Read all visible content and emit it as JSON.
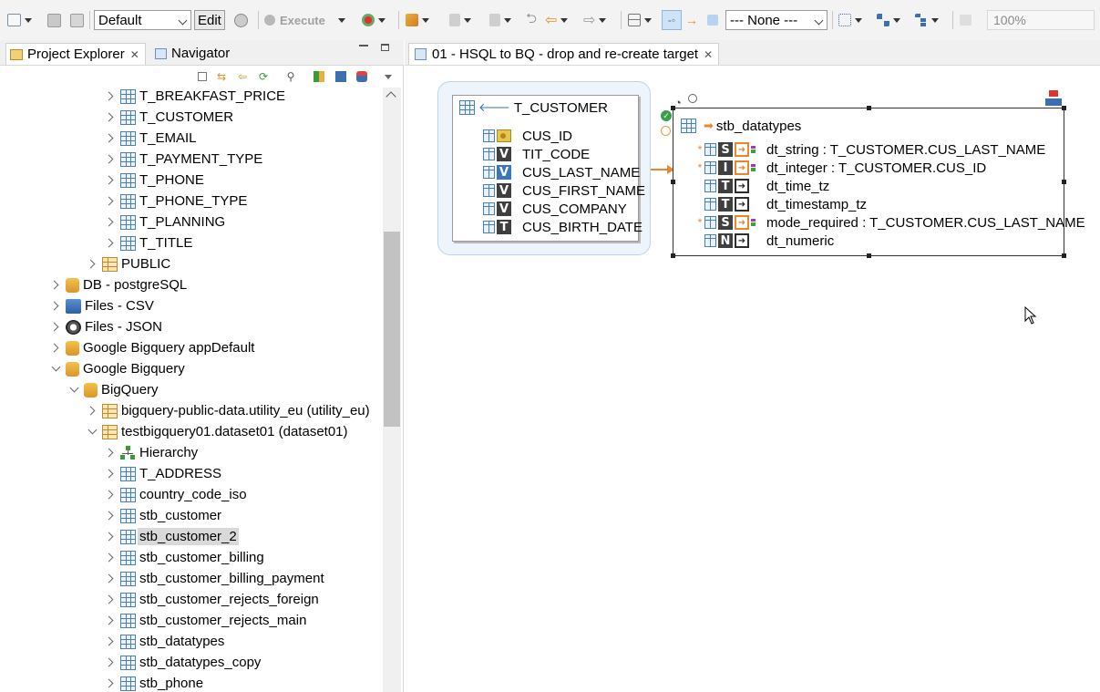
{
  "toolbar": {
    "profile_select": "Default",
    "edit_label": "Edit",
    "execute_label": "Execute",
    "none_select": "--- None ---",
    "zoom_value": "100%"
  },
  "left_panel": {
    "tabs": [
      {
        "label": "Project Explorer"
      },
      {
        "label": "Navigator"
      }
    ],
    "tree": [
      {
        "label": "T_BREAKFAST_PRICE",
        "icon": "table-icon"
      },
      {
        "label": "T_CUSTOMER",
        "icon": "table-icon"
      },
      {
        "label": "T_EMAIL",
        "icon": "table-icon"
      },
      {
        "label": "T_PAYMENT_TYPE",
        "icon": "table-icon"
      },
      {
        "label": "T_PHONE",
        "icon": "table-icon"
      },
      {
        "label": "T_PHONE_TYPE",
        "icon": "table-icon"
      },
      {
        "label": "T_PLANNING",
        "icon": "table-icon"
      },
      {
        "label": "T_TITLE",
        "icon": "table-icon"
      },
      {
        "label": "PUBLIC",
        "icon": "schema-icon"
      },
      {
        "label": "DB - postgreSQL",
        "icon": "database-icon"
      },
      {
        "label": "Files - CSV",
        "icon": "csv-icon"
      },
      {
        "label": "Files - JSON",
        "icon": "json-icon"
      },
      {
        "label": "Google Bigquery appDefault",
        "icon": "database-icon"
      },
      {
        "label": "Google Bigquery",
        "icon": "database-icon"
      },
      {
        "label": "BigQuery",
        "icon": "database-icon"
      },
      {
        "label": "bigquery-public-data.utility_eu (utility_eu)",
        "icon": "schema-icon"
      },
      {
        "label": "testbigquery01.dataset01 (dataset01)",
        "icon": "schema-icon"
      },
      {
        "label": "Hierarchy",
        "icon": "hierarchy-icon"
      },
      {
        "label": "T_ADDRESS",
        "icon": "table-icon"
      },
      {
        "label": "country_code_iso",
        "icon": "table-icon"
      },
      {
        "label": "stb_customer",
        "icon": "table-icon"
      },
      {
        "label": "stb_customer_2",
        "icon": "table-icon"
      },
      {
        "label": "stb_customer_billing",
        "icon": "table-icon"
      },
      {
        "label": "stb_customer_billing_payment",
        "icon": "table-icon"
      },
      {
        "label": "stb_customer_rejects_foreign",
        "icon": "table-icon"
      },
      {
        "label": "stb_customer_rejects_main",
        "icon": "table-icon"
      },
      {
        "label": "stb_datatypes",
        "icon": "table-icon"
      },
      {
        "label": "stb_datatypes_copy",
        "icon": "table-icon"
      },
      {
        "label": "stb_phone",
        "icon": "table-icon"
      }
    ]
  },
  "editor": {
    "tab_label": "01 - HSQL to BQ - drop and re-create target",
    "source": {
      "title": "T_CUSTOMER",
      "fields": [
        {
          "name": "CUS_ID",
          "type": "key"
        },
        {
          "name": "TIT_CODE",
          "type": "V"
        },
        {
          "name": "CUS_LAST_NAME",
          "type": "V"
        },
        {
          "name": "CUS_FIRST_NAME",
          "type": "V"
        },
        {
          "name": "CUS_COMPANY",
          "type": "V"
        },
        {
          "name": "CUS_BIRTH_DATE",
          "type": "T"
        }
      ]
    },
    "target": {
      "title": "stb_datatypes",
      "fields": [
        {
          "type": "S",
          "label": "dt_string : T_CUSTOMER.CUS_LAST_NAME",
          "mapped": true
        },
        {
          "type": "I",
          "label": "dt_integer : T_CUSTOMER.CUS_ID",
          "mapped": true
        },
        {
          "type": "T",
          "label": "dt_time_tz",
          "mapped": false
        },
        {
          "type": "T",
          "label": "dt_timestamp_tz",
          "mapped": false
        },
        {
          "type": "S",
          "label": "mode_required : T_CUSTOMER.CUS_LAST_NAME",
          "mapped": true
        },
        {
          "type": "N",
          "label": "dt_numeric",
          "mapped": false
        }
      ]
    }
  }
}
